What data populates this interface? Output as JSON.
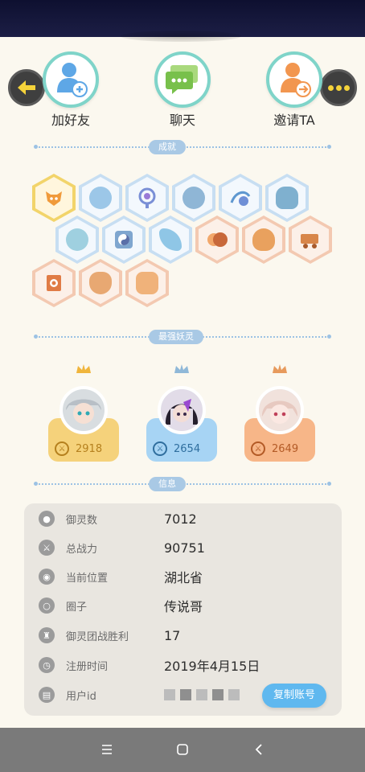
{
  "header": {
    "back_icon": "arrow-left-icon",
    "more_icon": "more-dots-icon"
  },
  "actions": [
    {
      "label": "加好友",
      "icon": "add-friend-icon"
    },
    {
      "label": "聊天",
      "icon": "chat-icon"
    },
    {
      "label": "邀请TA",
      "icon": "invite-icon"
    }
  ],
  "sections": {
    "achievements": "成就",
    "strongest": "最强妖灵",
    "info": "信息"
  },
  "achievements": {
    "count": 15,
    "colors": {
      "gold": "#f2d46a",
      "blue": "#c7def2",
      "orange": "#f3c9b1"
    }
  },
  "strongest_spirits": [
    {
      "power": "2918",
      "color": "#f5d27b"
    },
    {
      "power": "2654",
      "color": "#a7d4f4"
    },
    {
      "power": "2649",
      "color": "#f7b688"
    }
  ],
  "info": {
    "rows": [
      {
        "key": "御灵数",
        "value": "7012",
        "icon": "spirit-count-icon"
      },
      {
        "key": "总战力",
        "value": "90751",
        "icon": "power-icon"
      },
      {
        "key": "当前位置",
        "value": "湖北省",
        "icon": "location-icon"
      },
      {
        "key": "圈子",
        "value": "传说哥",
        "icon": "circle-icon"
      },
      {
        "key": "御灵团战胜利",
        "value": "17",
        "icon": "trophy-icon"
      },
      {
        "key": "注册时间",
        "value": "2019年4月15日",
        "icon": "clock-icon"
      },
      {
        "key": "用户id",
        "value": "",
        "icon": "id-card-icon"
      }
    ],
    "copy_button": "复制账号"
  },
  "nav": {
    "menu_icon": "menu-icon",
    "home_icon": "home-square-icon",
    "back_icon": "back-chevron-icon"
  }
}
